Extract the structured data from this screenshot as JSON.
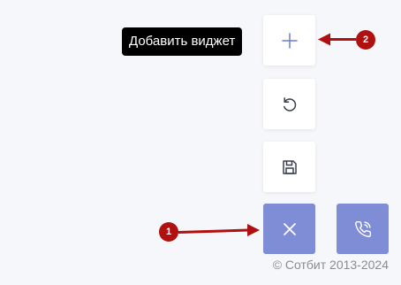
{
  "tooltip": {
    "text": "Добавить виджет"
  },
  "buttons": {
    "add": {
      "icon": "plus-icon"
    },
    "reset": {
      "icon": "reset-icon"
    },
    "save": {
      "icon": "save-icon"
    },
    "close": {
      "icon": "close-icon"
    },
    "call": {
      "icon": "phone-call-icon"
    }
  },
  "markers": [
    "1",
    "2"
  ],
  "footer": {
    "copyright": "© Сотбит 2013-2024"
  },
  "colors": {
    "background": "#f6f7fa",
    "accent": "#7f8dd6",
    "plus_icon": "#6c7bd0",
    "dark_icon": "#3a3f4c",
    "marker": "#b01010",
    "tooltip_bg": "#000000"
  }
}
